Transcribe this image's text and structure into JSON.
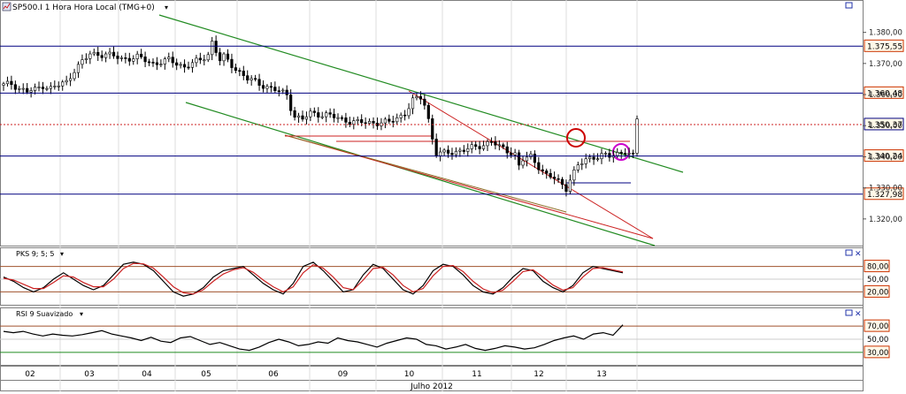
{
  "header": {
    "symbol": "SP500.I",
    "interval": "1 Hora",
    "timezone": "Hora Local (TMG+0)"
  },
  "icons": {
    "chart_icon": "chart-icon",
    "dropdown": "chevron-down-icon",
    "maximize": "maximize-icon",
    "close": "close-icon"
  },
  "colors": {
    "candle": "#000000",
    "resistance": "#000080",
    "channel": "#228b22",
    "triangle": "#cc2222",
    "signal": "#cc2222",
    "circle_red": "#cc0000",
    "circle_magenta": "#cc00cc",
    "label_border": "#cc3300"
  },
  "chart_data": [
    {
      "type": "candlestick",
      "panel": "price",
      "title": "SP500.I 1 Hora Hora Local (TMG+0)",
      "x_labels": [
        "02",
        "03",
        "04",
        "05",
        "06",
        "09",
        "10",
        "11",
        "12",
        "13"
      ],
      "x_axis_title": "Julho 2012",
      "y_ticks": [
        1320,
        1330,
        1340,
        1350,
        1360,
        1370,
        1380
      ],
      "y_tick_labels": [
        "1.320,00",
        "1.330,00",
        "1.340,00",
        "1.350,00",
        "1.360,00",
        "1.370,00",
        "1.380,00"
      ],
      "ylim": [
        1312,
        1387
      ],
      "close_points": [
        [
          0,
          1363
        ],
        [
          2,
          1363.5
        ],
        [
          4,
          1362
        ],
        [
          6,
          1361
        ],
        [
          8,
          1361.5
        ],
        [
          10,
          1363
        ],
        [
          12,
          1362
        ],
        [
          14,
          1363
        ],
        [
          16,
          1364
        ],
        [
          18,
          1368
        ],
        [
          22,
          1373
        ],
        [
          26,
          1373
        ],
        [
          30,
          1371.5
        ],
        [
          34,
          1372
        ],
        [
          38,
          1370
        ],
        [
          42,
          1371
        ],
        [
          46,
          1369
        ],
        [
          48,
          1370
        ],
        [
          50,
          1371
        ],
        [
          52,
          1373
        ],
        [
          53,
          1377
        ],
        [
          54,
          1374
        ],
        [
          55,
          1371
        ],
        [
          56,
          1372
        ],
        [
          58,
          1369.5
        ],
        [
          62,
          1365
        ],
        [
          66,
          1363
        ],
        [
          70,
          1361
        ],
        [
          72,
          1360
        ],
        [
          73,
          1356
        ],
        [
          74,
          1353
        ],
        [
          76,
          1352
        ],
        [
          78,
          1354
        ],
        [
          82,
          1353.5
        ],
        [
          86,
          1352
        ],
        [
          90,
          1351
        ],
        [
          94,
          1351
        ],
        [
          98,
          1351
        ],
        [
          102,
          1354
        ],
        [
          104,
          1358
        ],
        [
          106,
          1359
        ],
        [
          107,
          1357
        ],
        [
          108,
          1352
        ],
        [
          109,
          1346
        ],
        [
          110,
          1341
        ],
        [
          112,
          1341
        ],
        [
          116,
          1342
        ],
        [
          120,
          1343
        ],
        [
          124,
          1345
        ],
        [
          126,
          1343
        ],
        [
          128,
          1342
        ],
        [
          130,
          1341
        ],
        [
          131,
          1337
        ],
        [
          132,
          1339
        ],
        [
          134,
          1340
        ],
        [
          136,
          1337
        ],
        [
          138,
          1334
        ],
        [
          140,
          1333
        ],
        [
          142,
          1331
        ],
        [
          143,
          1330
        ],
        [
          144,
          1333
        ],
        [
          146,
          1337
        ],
        [
          148,
          1339
        ],
        [
          150,
          1340
        ],
        [
          152,
          1340.5
        ],
        [
          154,
          1340
        ],
        [
          156,
          1341
        ],
        [
          158,
          1342
        ],
        [
          160,
          1340
        ],
        [
          161,
          1352
        ]
      ],
      "levels": [
        {
          "label": "1.375,55",
          "value": 1375.55
        },
        {
          "label": "1.360,48",
          "value": 1360.48
        },
        {
          "label": "1.350,37",
          "value": 1350.37,
          "style": "dotted",
          "current": true
        },
        {
          "label": "1.340,24",
          "value": 1340.24
        },
        {
          "label": "1.327,98",
          "value": 1327.98
        }
      ]
    },
    {
      "type": "line",
      "panel": "oscillator",
      "title": "PKS 9; 5; 5",
      "y_ticks": [
        20,
        50,
        80
      ],
      "y_tick_labels": [
        "20,00",
        "50,00",
        "80,00"
      ],
      "ylim": [
        0,
        100
      ],
      "series": [
        {
          "values": [
            55,
            45,
            30,
            20,
            30,
            50,
            65,
            50,
            35,
            25,
            35,
            60,
            85,
            90,
            85,
            70,
            45,
            20,
            10,
            15,
            30,
            55,
            70,
            75,
            80,
            60,
            40,
            25,
            15,
            40,
            80,
            90,
            70,
            45,
            20,
            25,
            60,
            85,
            75,
            50,
            25,
            15,
            35,
            70,
            85,
            80,
            60,
            35,
            20,
            15,
            30,
            55,
            75,
            70,
            45,
            30,
            20,
            35,
            65,
            80,
            75,
            70,
            65
          ]
        },
        {
          "values": [
            52,
            48,
            38,
            28,
            28,
            42,
            58,
            55,
            42,
            32,
            32,
            50,
            75,
            87,
            86,
            76,
            55,
            32,
            18,
            15,
            25,
            45,
            62,
            72,
            77,
            66,
            48,
            32,
            20,
            32,
            65,
            84,
            76,
            55,
            30,
            25,
            48,
            75,
            78,
            60,
            35,
            20,
            28,
            58,
            80,
            82,
            68,
            45,
            27,
            18,
            24,
            45,
            68,
            72,
            55,
            36,
            24,
            30,
            55,
            75,
            77,
            72,
            67
          ]
        }
      ]
    },
    {
      "type": "line",
      "panel": "rsi",
      "title": "RSI 9 Suavizado",
      "y_ticks": [
        30,
        50,
        70
      ],
      "y_tick_labels": [
        "30,00",
        "50,00",
        "70,00"
      ],
      "ylim": [
        15,
        85
      ],
      "series": [
        {
          "values": [
            62,
            60,
            62,
            58,
            55,
            58,
            56,
            55,
            57,
            60,
            63,
            58,
            55,
            52,
            48,
            53,
            47,
            45,
            52,
            54,
            48,
            42,
            45,
            40,
            35,
            33,
            38,
            45,
            50,
            46,
            40,
            42,
            46,
            44,
            52,
            48,
            46,
            42,
            38,
            44,
            48,
            52,
            50,
            42,
            40,
            35,
            38,
            42,
            36,
            33,
            36,
            40,
            38,
            35,
            37,
            42,
            48,
            52,
            55,
            50,
            58,
            60,
            56,
            72
          ]
        }
      ]
    }
  ],
  "panels": {
    "pks": {
      "label": "PKS 9; 5; 5",
      "marks": [
        "80,00",
        "50,00",
        "20,00"
      ]
    },
    "rsi": {
      "label": "RSI 9 Suavizado",
      "marks": [
        "70,00",
        "50,00",
        "30,00"
      ]
    }
  }
}
